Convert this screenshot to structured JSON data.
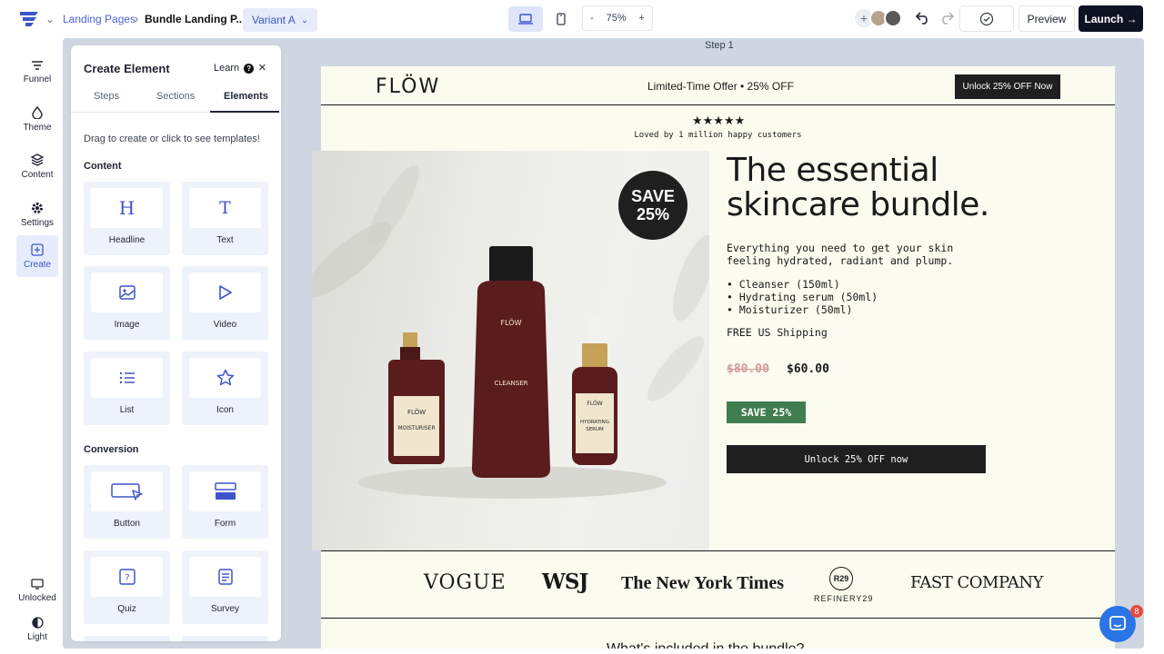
{
  "topbar": {
    "breadcrumb_parent": "Landing Pages",
    "breadcrumb_current": "Bundle Landing P...",
    "variant": "Variant A",
    "zoom_minus": "-",
    "zoom_value": "75%",
    "zoom_plus": "+",
    "collab_plus": "+",
    "preview": "Preview",
    "launch": "Launch →"
  },
  "rail": {
    "funnel": "Funnel",
    "theme": "Theme",
    "content": "Content",
    "settings": "Settings",
    "create": "Create",
    "unlocked": "Unlocked",
    "light": "Light"
  },
  "canvas": {
    "step_label": "Step 1"
  },
  "panel": {
    "title": "Create Element",
    "learn": "Learn",
    "tabs": [
      "Steps",
      "Sections",
      "Elements"
    ],
    "hint": "Drag to create or click to see templates!",
    "content_label": "Content",
    "conversion_label": "Conversion",
    "content_items": [
      "Headline",
      "Text",
      "Image",
      "Video",
      "List",
      "Icon"
    ],
    "conversion_items": [
      "Button",
      "Form",
      "Quiz",
      "Survey"
    ]
  },
  "landing": {
    "logo": "FLÖW",
    "offer": "Limited-Time Offer • 25% OFF",
    "unlock_top": "Unlock 25% OFF  Now",
    "stars": "★★★★★",
    "loved": "Loved by 1 million happy customers",
    "badge_line1": "SAVE",
    "badge_line2": "25%",
    "headline_line1": "The essential",
    "headline_line2": "skincare bundle.",
    "desc_line1": "Everything you need to get your skin",
    "desc_line2": "feeling hydrated, radiant and plump.",
    "bullets": [
      "• Cleanser (150ml)",
      "• Hydrating serum (50ml)",
      "• Moisturizer (50ml)"
    ],
    "shipping": "FREE US Shipping",
    "old_price": "$80.00",
    "new_price": "$60.00",
    "save_pill": "SAVE 25%",
    "cta": "Unlock 25% OFF now",
    "press": [
      "VOGUE",
      "WSJ",
      "The New York Times",
      "REFINERY29",
      "FAST COMPANY"
    ],
    "refinery_mark": "R29",
    "next_heading": "What's included in the bundle?",
    "bottles": {
      "left_brand": "FLÖW",
      "left_name": "MOISTURISER",
      "center_brand": "FLÖW",
      "center_name": "CLEANSER",
      "right_brand": "FLÖW",
      "right_name1": "HYDRATING",
      "right_name2": "SERUM"
    }
  },
  "chat": {
    "badge": "8"
  },
  "colors": {
    "accent": "#3d55c9",
    "save_green": "#3f7d4e",
    "lp_bg": "#fbfbef",
    "bottle": "#5a1c1c",
    "chat": "#2a74e6"
  }
}
